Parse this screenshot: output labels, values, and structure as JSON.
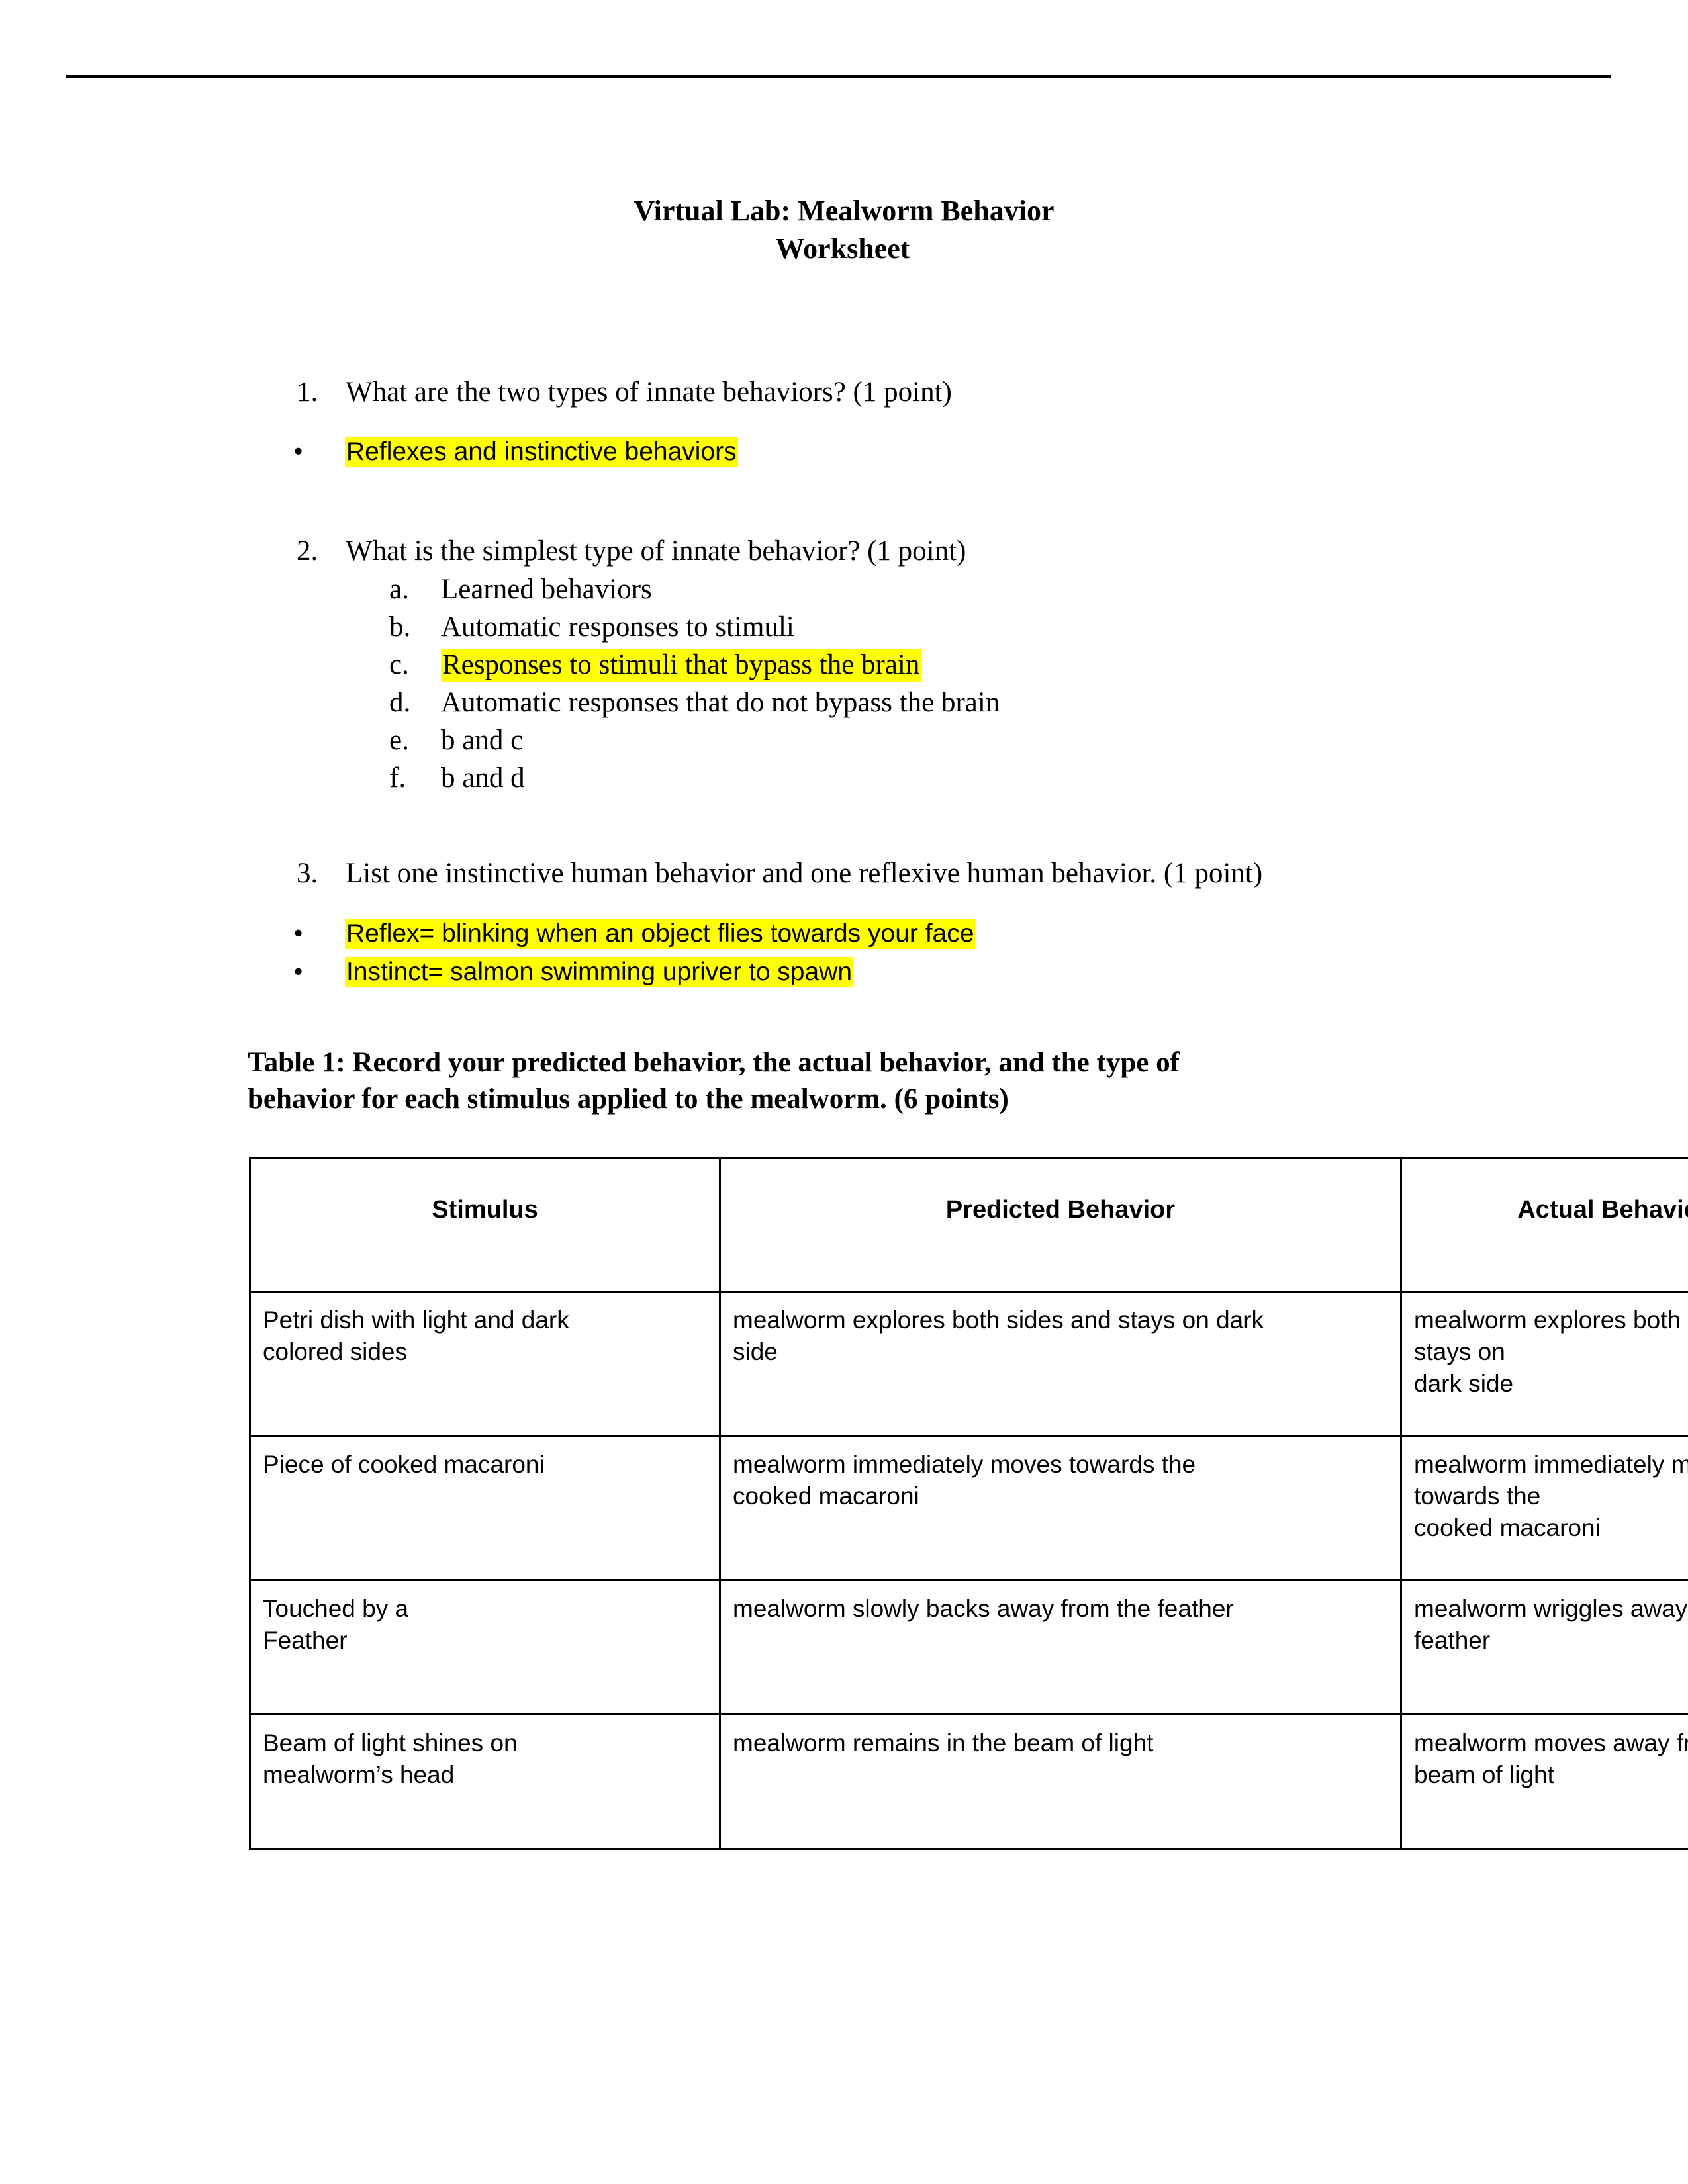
{
  "document": {
    "title_line1": "Virtual Lab:  Mealworm Behavior",
    "title_line2": "Worksheet"
  },
  "questions": [
    {
      "number": "1.",
      "text": "What are the two types of innate behaviors? (1 point)",
      "answers": [
        {
          "bullet": "•",
          "text": "Reflexes and instinctive behaviors",
          "highlighted": true
        }
      ]
    },
    {
      "number": "2.",
      "text": "What is the simplest type of innate behavior? (1 point)",
      "options": [
        {
          "letter": "a.",
          "text": "Learned behaviors",
          "highlighted": false
        },
        {
          "letter": "b.",
          "text": "Automatic responses to stimuli",
          "highlighted": false
        },
        {
          "letter": "c.",
          "text": "Responses to stimuli that bypass the brain",
          "highlighted": true
        },
        {
          "letter": "d.",
          "text": "Automatic responses that do not bypass the brain",
          "highlighted": false
        },
        {
          "letter": "e.",
          "text": "b and c",
          "highlighted": false
        },
        {
          "letter": "f.",
          "text": "b and d",
          "highlighted": false
        }
      ]
    },
    {
      "number": "3.",
      "text": "List one instinctive human behavior and one reflexive human behavior. (1 point)",
      "answers": [
        {
          "bullet": "•",
          "text": "Reflex= blinking when an object flies towards your face",
          "highlighted": true
        },
        {
          "bullet": "•",
          "text": "Instinct= salmon swimming upriver to spawn",
          "highlighted": true
        }
      ]
    }
  ],
  "table": {
    "caption_line1": "Table 1:  Record your predicted behavior, the actual behavior, and the type of",
    "caption_line2": "behavior for each stimulus applied to the mealworm. (6 points)",
    "headers": [
      "Stimulus",
      "Predicted Behavior",
      "Actual Behavior"
    ],
    "rows": [
      {
        "stimulus": "Petri dish with light and dark\ncolored sides",
        "predicted": "mealworm explores both sides and stays on dark\nside",
        "actual": "mealworm explores both sides and stays on\ndark side"
      },
      {
        "stimulus": "Piece of cooked macaroni",
        "predicted": "mealworm immediately moves towards the\ncooked macaroni",
        "actual": "mealworm immediately moves towards the\ncooked macaroni"
      },
      {
        "stimulus": "Touched by a\nFeather",
        "predicted": "mealworm slowly backs away from the feather",
        "actual": "mealworm wriggles away from the feather"
      },
      {
        "stimulus": "Beam of light shines on\nmealworm’s head",
        "predicted": "mealworm remains in the beam of light",
        "actual": "mealworm moves away from the beam of light"
      }
    ]
  },
  "colors": {
    "highlight": "#ffff00",
    "text": "#000000",
    "background": "#ffffff"
  }
}
